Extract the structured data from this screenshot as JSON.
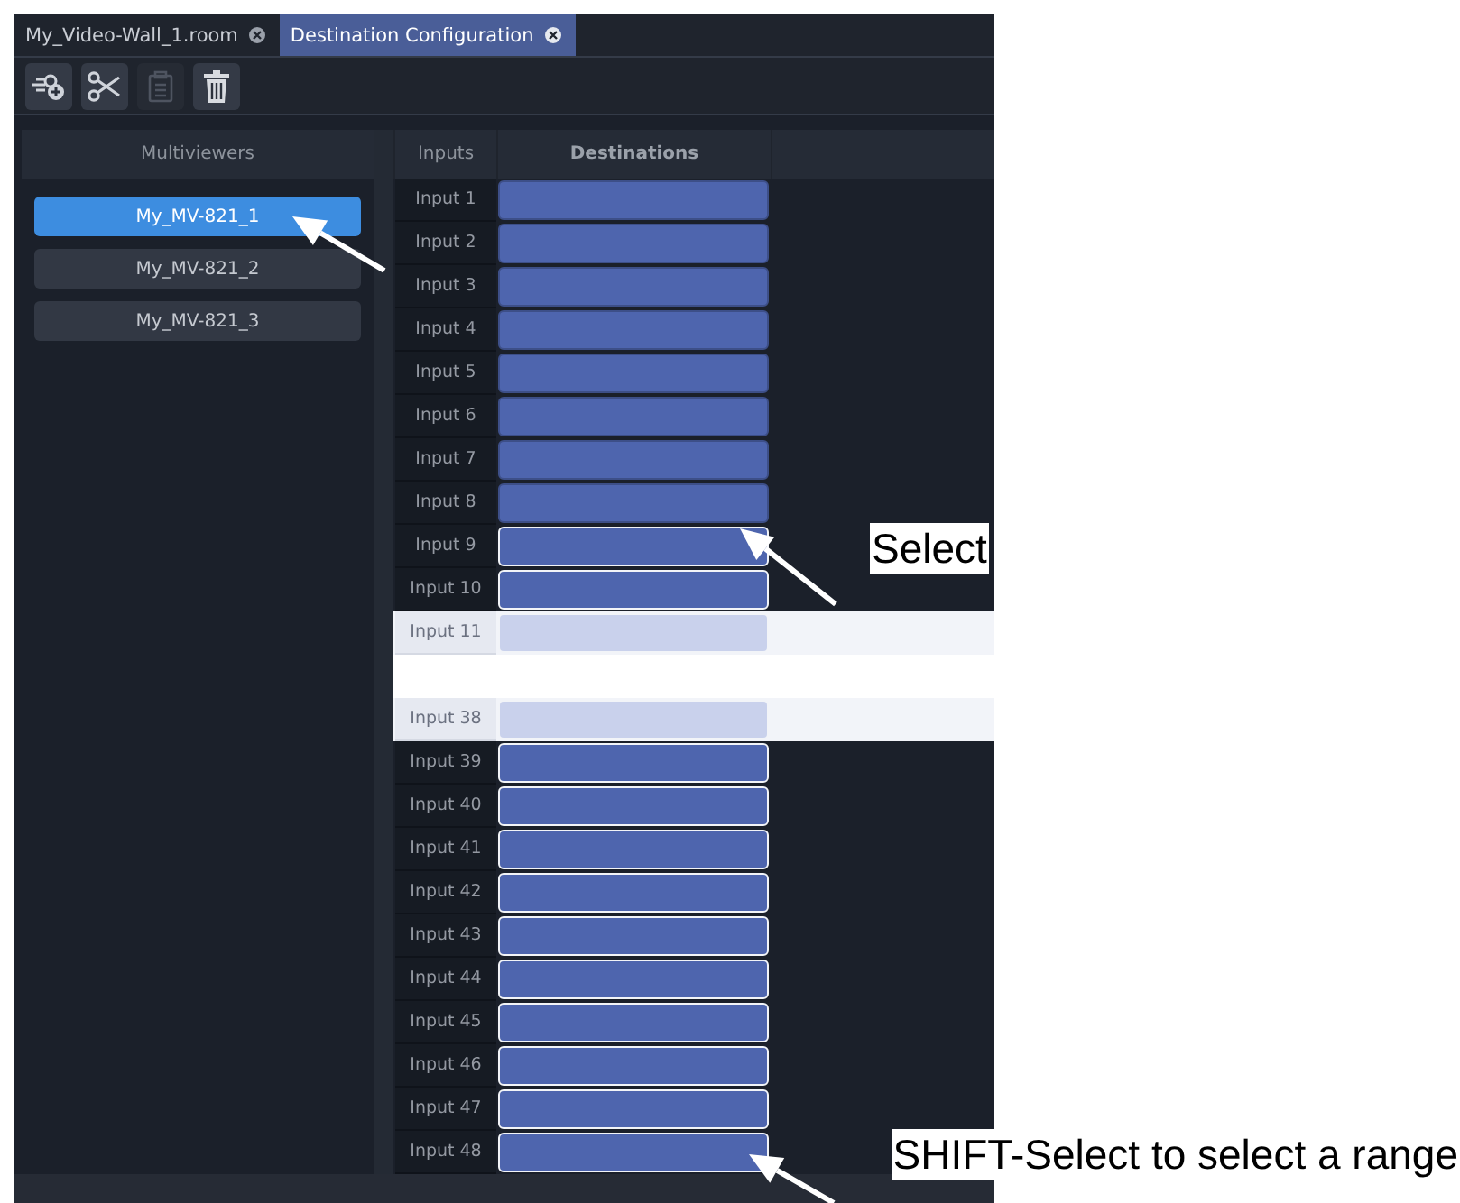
{
  "tabs": [
    {
      "label": "My_Video-Wall_1.room",
      "selected": false
    },
    {
      "label": "Destination Configuration",
      "selected": true
    }
  ],
  "toolbar": [
    {
      "kind": "add",
      "disabled": false
    },
    {
      "kind": "cut",
      "disabled": false
    },
    {
      "kind": "paste",
      "disabled": true
    },
    {
      "kind": "delete",
      "disabled": false
    }
  ],
  "multiviewers": {
    "header": "Multiviewers",
    "items": [
      {
        "label": "My_MV-821_1",
        "selected": true
      },
      {
        "label": "My_MV-821_2",
        "selected": false
      },
      {
        "label": "My_MV-821_3",
        "selected": false
      }
    ]
  },
  "table": {
    "columns": [
      "Inputs",
      "Destinations"
    ],
    "row_groups": [
      [
        {
          "input": "Input 1",
          "selected": false,
          "faded": false
        },
        {
          "input": "Input 2",
          "selected": false,
          "faded": false
        },
        {
          "input": "Input 3",
          "selected": false,
          "faded": false
        },
        {
          "input": "Input 4",
          "selected": false,
          "faded": false
        },
        {
          "input": "Input 5",
          "selected": false,
          "faded": false
        },
        {
          "input": "Input 6",
          "selected": false,
          "faded": false
        },
        {
          "input": "Input 7",
          "selected": false,
          "faded": false
        },
        {
          "input": "Input 8",
          "selected": false,
          "faded": false
        },
        {
          "input": "Input 9",
          "selected": true,
          "faded": false
        },
        {
          "input": "Input 10",
          "selected": true,
          "faded": false
        },
        {
          "input": "Input 11",
          "selected": true,
          "faded": true
        }
      ],
      [
        {
          "input": "Input 38",
          "selected": true,
          "faded": true
        },
        {
          "input": "Input 39",
          "selected": true,
          "faded": false
        },
        {
          "input": "Input 40",
          "selected": true,
          "faded": false
        },
        {
          "input": "Input 41",
          "selected": true,
          "faded": false
        },
        {
          "input": "Input 42",
          "selected": true,
          "faded": false
        },
        {
          "input": "Input 43",
          "selected": true,
          "faded": false
        },
        {
          "input": "Input 44",
          "selected": true,
          "faded": false
        },
        {
          "input": "Input 45",
          "selected": true,
          "faded": false
        },
        {
          "input": "Input 46",
          "selected": true,
          "faded": false
        },
        {
          "input": "Input 47",
          "selected": true,
          "faded": false
        },
        {
          "input": "Input 48",
          "selected": true,
          "faded": false
        }
      ]
    ]
  },
  "callouts": [
    {
      "text": "Select"
    },
    {
      "text": "SHIFT-Select to select a range"
    }
  ]
}
